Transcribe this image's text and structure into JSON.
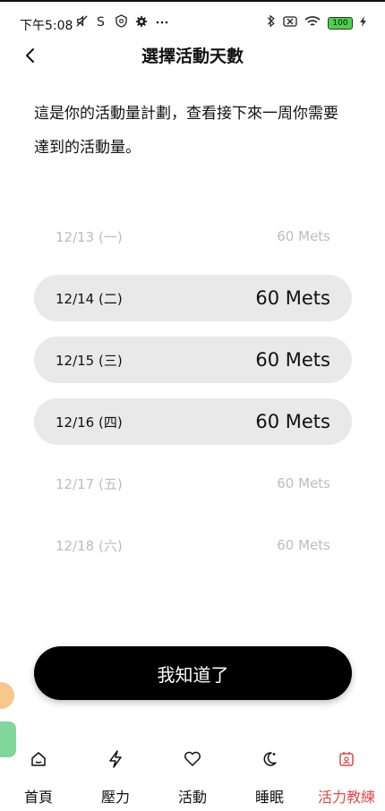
{
  "status_bar": {
    "time": "下午5:08",
    "battery": "100"
  },
  "header": {
    "title": "選擇活動天數"
  },
  "description": {
    "line1": "這是你的活動量計劃，查看接下來一周你需要",
    "line2": "達到的活動量。"
  },
  "days": [
    {
      "date": "12/13 (一)",
      "value": "60 Mets",
      "active": false
    },
    {
      "date": "12/14 (二)",
      "value": "60 Mets",
      "active": true
    },
    {
      "date": "12/15 (三)",
      "value": "60 Mets",
      "active": true
    },
    {
      "date": "12/16 (四)",
      "value": "60 Mets",
      "active": true
    },
    {
      "date": "12/17 (五)",
      "value": "60 Mets",
      "active": false
    },
    {
      "date": "12/18 (六)",
      "value": "60 Mets",
      "active": false
    }
  ],
  "confirm_button": {
    "label": "我知道了"
  },
  "tabs": [
    {
      "label": "首頁",
      "icon": "home-icon",
      "selected": false
    },
    {
      "label": "壓力",
      "icon": "bolt-icon",
      "selected": false
    },
    {
      "label": "活動",
      "icon": "heart-icon",
      "selected": false
    },
    {
      "label": "睡眠",
      "icon": "moon-icon",
      "selected": false
    },
    {
      "label": "活力教練",
      "icon": "coach-icon",
      "selected": true
    }
  ],
  "colors": {
    "accent": "#e04a4a",
    "active_row_bg": "#e9e9e9",
    "inactive_text": "#bdbdbd",
    "button_bg": "#000000"
  }
}
